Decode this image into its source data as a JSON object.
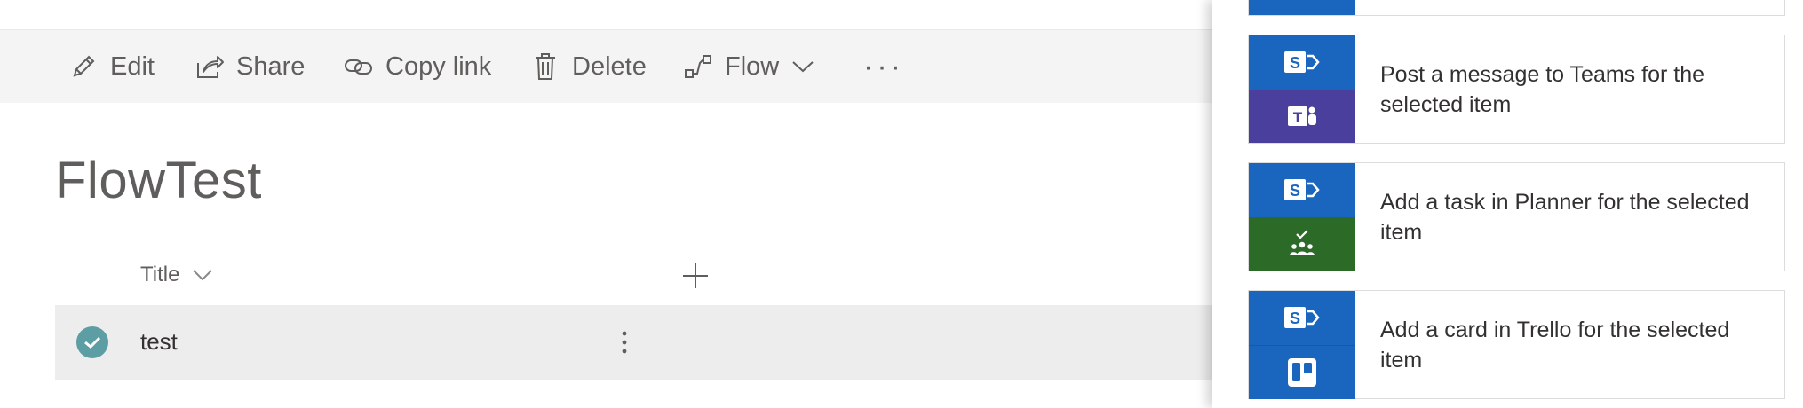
{
  "command_bar": {
    "items": [
      {
        "label": "Edit",
        "icon": "pencil-icon"
      },
      {
        "label": "Share",
        "icon": "share-icon"
      },
      {
        "label": "Copy link",
        "icon": "link-icon"
      },
      {
        "label": "Delete",
        "icon": "trash-icon"
      },
      {
        "label": "Flow",
        "icon": "flow-icon"
      }
    ],
    "more_label": "···"
  },
  "list": {
    "title": "FlowTest",
    "columns": [
      {
        "label": "Title"
      }
    ],
    "rows": [
      {
        "title": "test",
        "selected": true
      }
    ]
  },
  "flow_panel": {
    "templates": [
      {
        "text": "Post a message to Teams for the selected item",
        "bottom_icon": "teams-icon",
        "bottom_color": "#4b3f9e",
        "bottom_glyph": "T"
      },
      {
        "text": "Add a task in Planner for the selected item",
        "bottom_icon": "planner-icon",
        "bottom_color": "#2c6b27"
      },
      {
        "text": "Add a card in Trello for the selected item",
        "bottom_icon": "trello-icon",
        "bottom_color": "#1a66be"
      }
    ],
    "sharepoint_color": "#1a66be",
    "sharepoint_glyph": "S"
  }
}
